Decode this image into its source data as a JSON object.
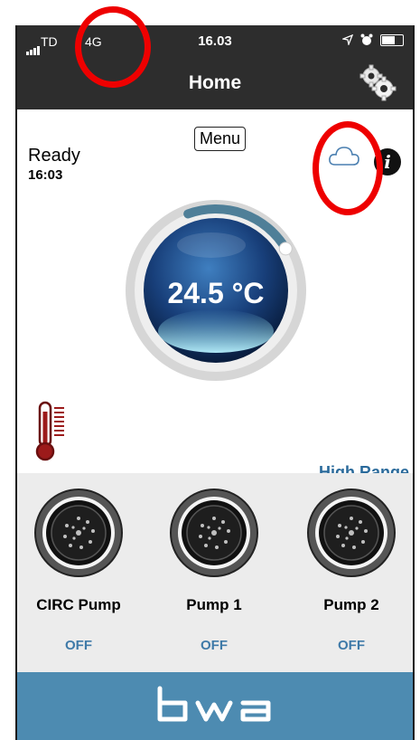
{
  "status_bar": {
    "carrier": "TD",
    "network": "4G",
    "time": "16.03",
    "icons": [
      "signal-icon",
      "location-arrow-icon",
      "alarm-icon",
      "battery-icon"
    ]
  },
  "nav": {
    "title": "Home",
    "settings_icon": "gears-icon"
  },
  "main": {
    "status": "Ready",
    "status_time": "16:03",
    "menu_label": "Menu",
    "temperature": "24.5 °C",
    "range_label": "High Range",
    "set_level_fraction": 0.22,
    "icons": [
      "cloud-icon",
      "info-icon",
      "thermometer-icon"
    ]
  },
  "pumps": [
    {
      "name": "CIRC Pump",
      "state": "OFF"
    },
    {
      "name": "Pump 1",
      "state": "OFF"
    },
    {
      "name": "Pump 2",
      "state": "OFF"
    }
  ],
  "footer": {
    "logo": "bwa"
  },
  "colors": {
    "bar": "#2d2d2d",
    "footer": "#4d8bb1",
    "accent_text": "#3f7aa8",
    "annotation": "#ee0000",
    "thermometer": "#9c1a1a"
  }
}
